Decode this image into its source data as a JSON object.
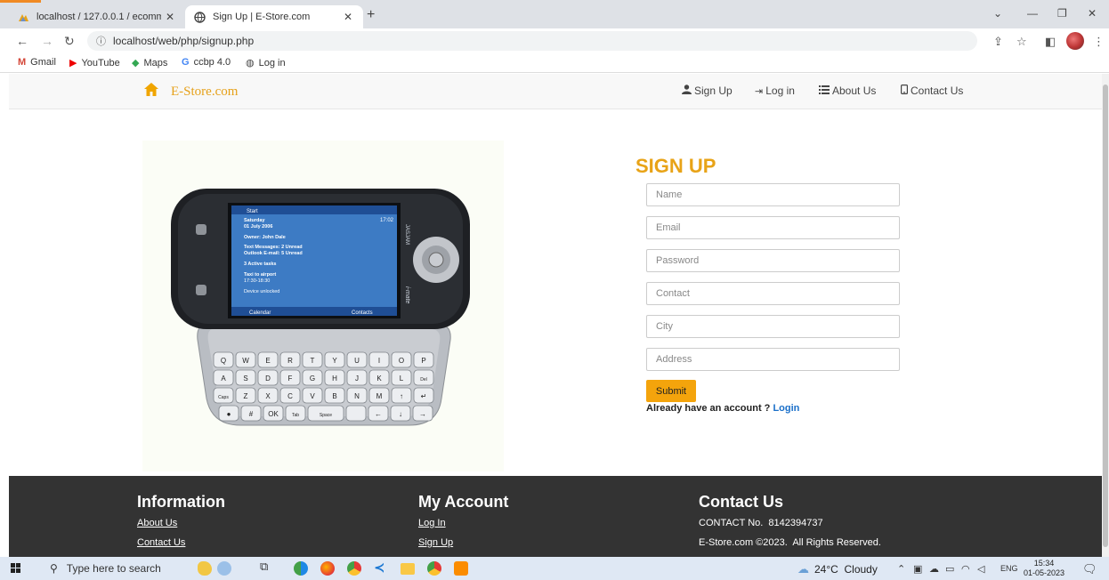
{
  "browser": {
    "tabs": [
      {
        "title": "localhost / 127.0.0.1 / ecommerce",
        "active": false
      },
      {
        "title": "Sign Up | E-Store.com",
        "active": true
      }
    ],
    "url": "localhost/web/php/signup.php",
    "bookmarks": [
      {
        "label": "Gmail",
        "icon": "gmail-icon"
      },
      {
        "label": "YouTube",
        "icon": "youtube-icon"
      },
      {
        "label": "Maps",
        "icon": "maps-icon"
      },
      {
        "label": "ccbp 4.0",
        "icon": "google-icon"
      },
      {
        "label": "Log in",
        "icon": "globe-icon"
      }
    ]
  },
  "header": {
    "brand": "E-Store.com",
    "nav": [
      {
        "label": "Sign Up",
        "icon": "user-icon"
      },
      {
        "label": "Log in",
        "icon": "login-icon"
      },
      {
        "label": "About Us",
        "icon": "list-icon"
      },
      {
        "label": "Contact Us",
        "icon": "phone-icon"
      }
    ]
  },
  "phone_screen": {
    "start": "Start",
    "time": "17:02",
    "day": "Saturday",
    "date": "01 July 2006",
    "owner": "Owner: John Dale",
    "messages": "Text Messages: 2 Unread",
    "outlook": "Outlook E-mail: 5 Unread",
    "tasks": "3 Active tasks",
    "appointment": "Taxi to airport",
    "appointment_time": "17:30-18:30",
    "device": "Device unlocked",
    "left_softkey": "Calendar",
    "right_softkey": "Contacts",
    "side_brand": "JASJAM",
    "side_brand2": "i-mate",
    "keyboard_rows": [
      [
        "Q",
        "W",
        "E",
        "R",
        "T",
        "Y",
        "U",
        "I",
        "O",
        "P"
      ],
      [
        "A",
        "S",
        "D",
        "F",
        "G",
        "H",
        "J",
        "K",
        "L",
        "Del"
      ],
      [
        "Caps",
        "Z",
        "X",
        "C",
        "V",
        "B",
        "N",
        "M",
        "↑",
        "↵"
      ],
      [
        "●",
        "#",
        "OK",
        "Tab",
        "Space",
        "",
        "←",
        "↓",
        "→"
      ]
    ]
  },
  "signup": {
    "title": "SIGN UP",
    "fields": [
      {
        "placeholder": "Name"
      },
      {
        "placeholder": "Email"
      },
      {
        "placeholder": "Password"
      },
      {
        "placeholder": "Contact"
      },
      {
        "placeholder": "City"
      },
      {
        "placeholder": "Address"
      }
    ],
    "submit": "Submit",
    "already_text": "Already have an account ? ",
    "login_link": "Login"
  },
  "footer": {
    "columns": [
      {
        "title": "Information",
        "links": [
          "About Us",
          "Contact Us"
        ]
      },
      {
        "title": "My Account",
        "links": [
          "Log In",
          "Sign Up"
        ]
      },
      {
        "title": "Contact Us",
        "links": [
          "CONTACT No.  8142394737",
          "E-Store.com ©2023.  All Rights Reserved."
        ]
      }
    ]
  },
  "taskbar": {
    "search_placeholder": "Type here to search",
    "weather": "24°C  Cloudy",
    "language": "ENG",
    "time": "15:34",
    "date": "01-05-2023"
  },
  "colors": {
    "accent": "#f4a40c",
    "brand": "#e6a11a",
    "footer": "#333333",
    "link": "#1a6fc9"
  }
}
